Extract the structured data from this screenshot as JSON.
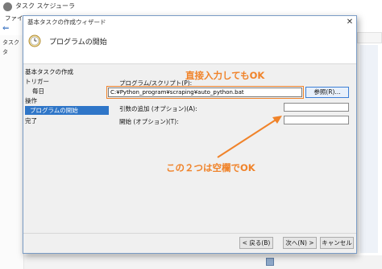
{
  "background_window": {
    "title": "タスク スケジューラ",
    "menu_label": "ファイル",
    "tree_items": [
      "タスク",
      "タ"
    ]
  },
  "dialog": {
    "title": "基本タスクの作成ウィザード",
    "header_title": "プログラムの開始",
    "close_glyph": "✕"
  },
  "steps": [
    {
      "label": "基本タスクの作成"
    },
    {
      "label": "トリガー"
    },
    {
      "label": "毎日"
    },
    {
      "label": "操作"
    },
    {
      "label": "プログラムの開始"
    },
    {
      "label": "完了"
    }
  ],
  "form": {
    "program_label": "プログラム/スクリプト(P):",
    "program_value": "C:¥Python_program¥scraping¥auto_python.bat",
    "browse_label": "参照(R)...",
    "args_label": "引数の追加 (オプション)(A):",
    "args_value": "",
    "start_label": "開始 (オプション)(T):",
    "start_value": ""
  },
  "annotations": {
    "direct_input": "直接入力してもOK",
    "two_blank": "この２つは空欄でOK",
    "color": "#f0832a"
  },
  "buttons": {
    "back": "< 戻る(B)",
    "next": "次へ(N) >",
    "cancel": "キャンセル"
  },
  "colors": {
    "selected_step": "#2f76c8",
    "dialog_border": "#7a9cc6",
    "browse_border": "#3c7fd6"
  }
}
